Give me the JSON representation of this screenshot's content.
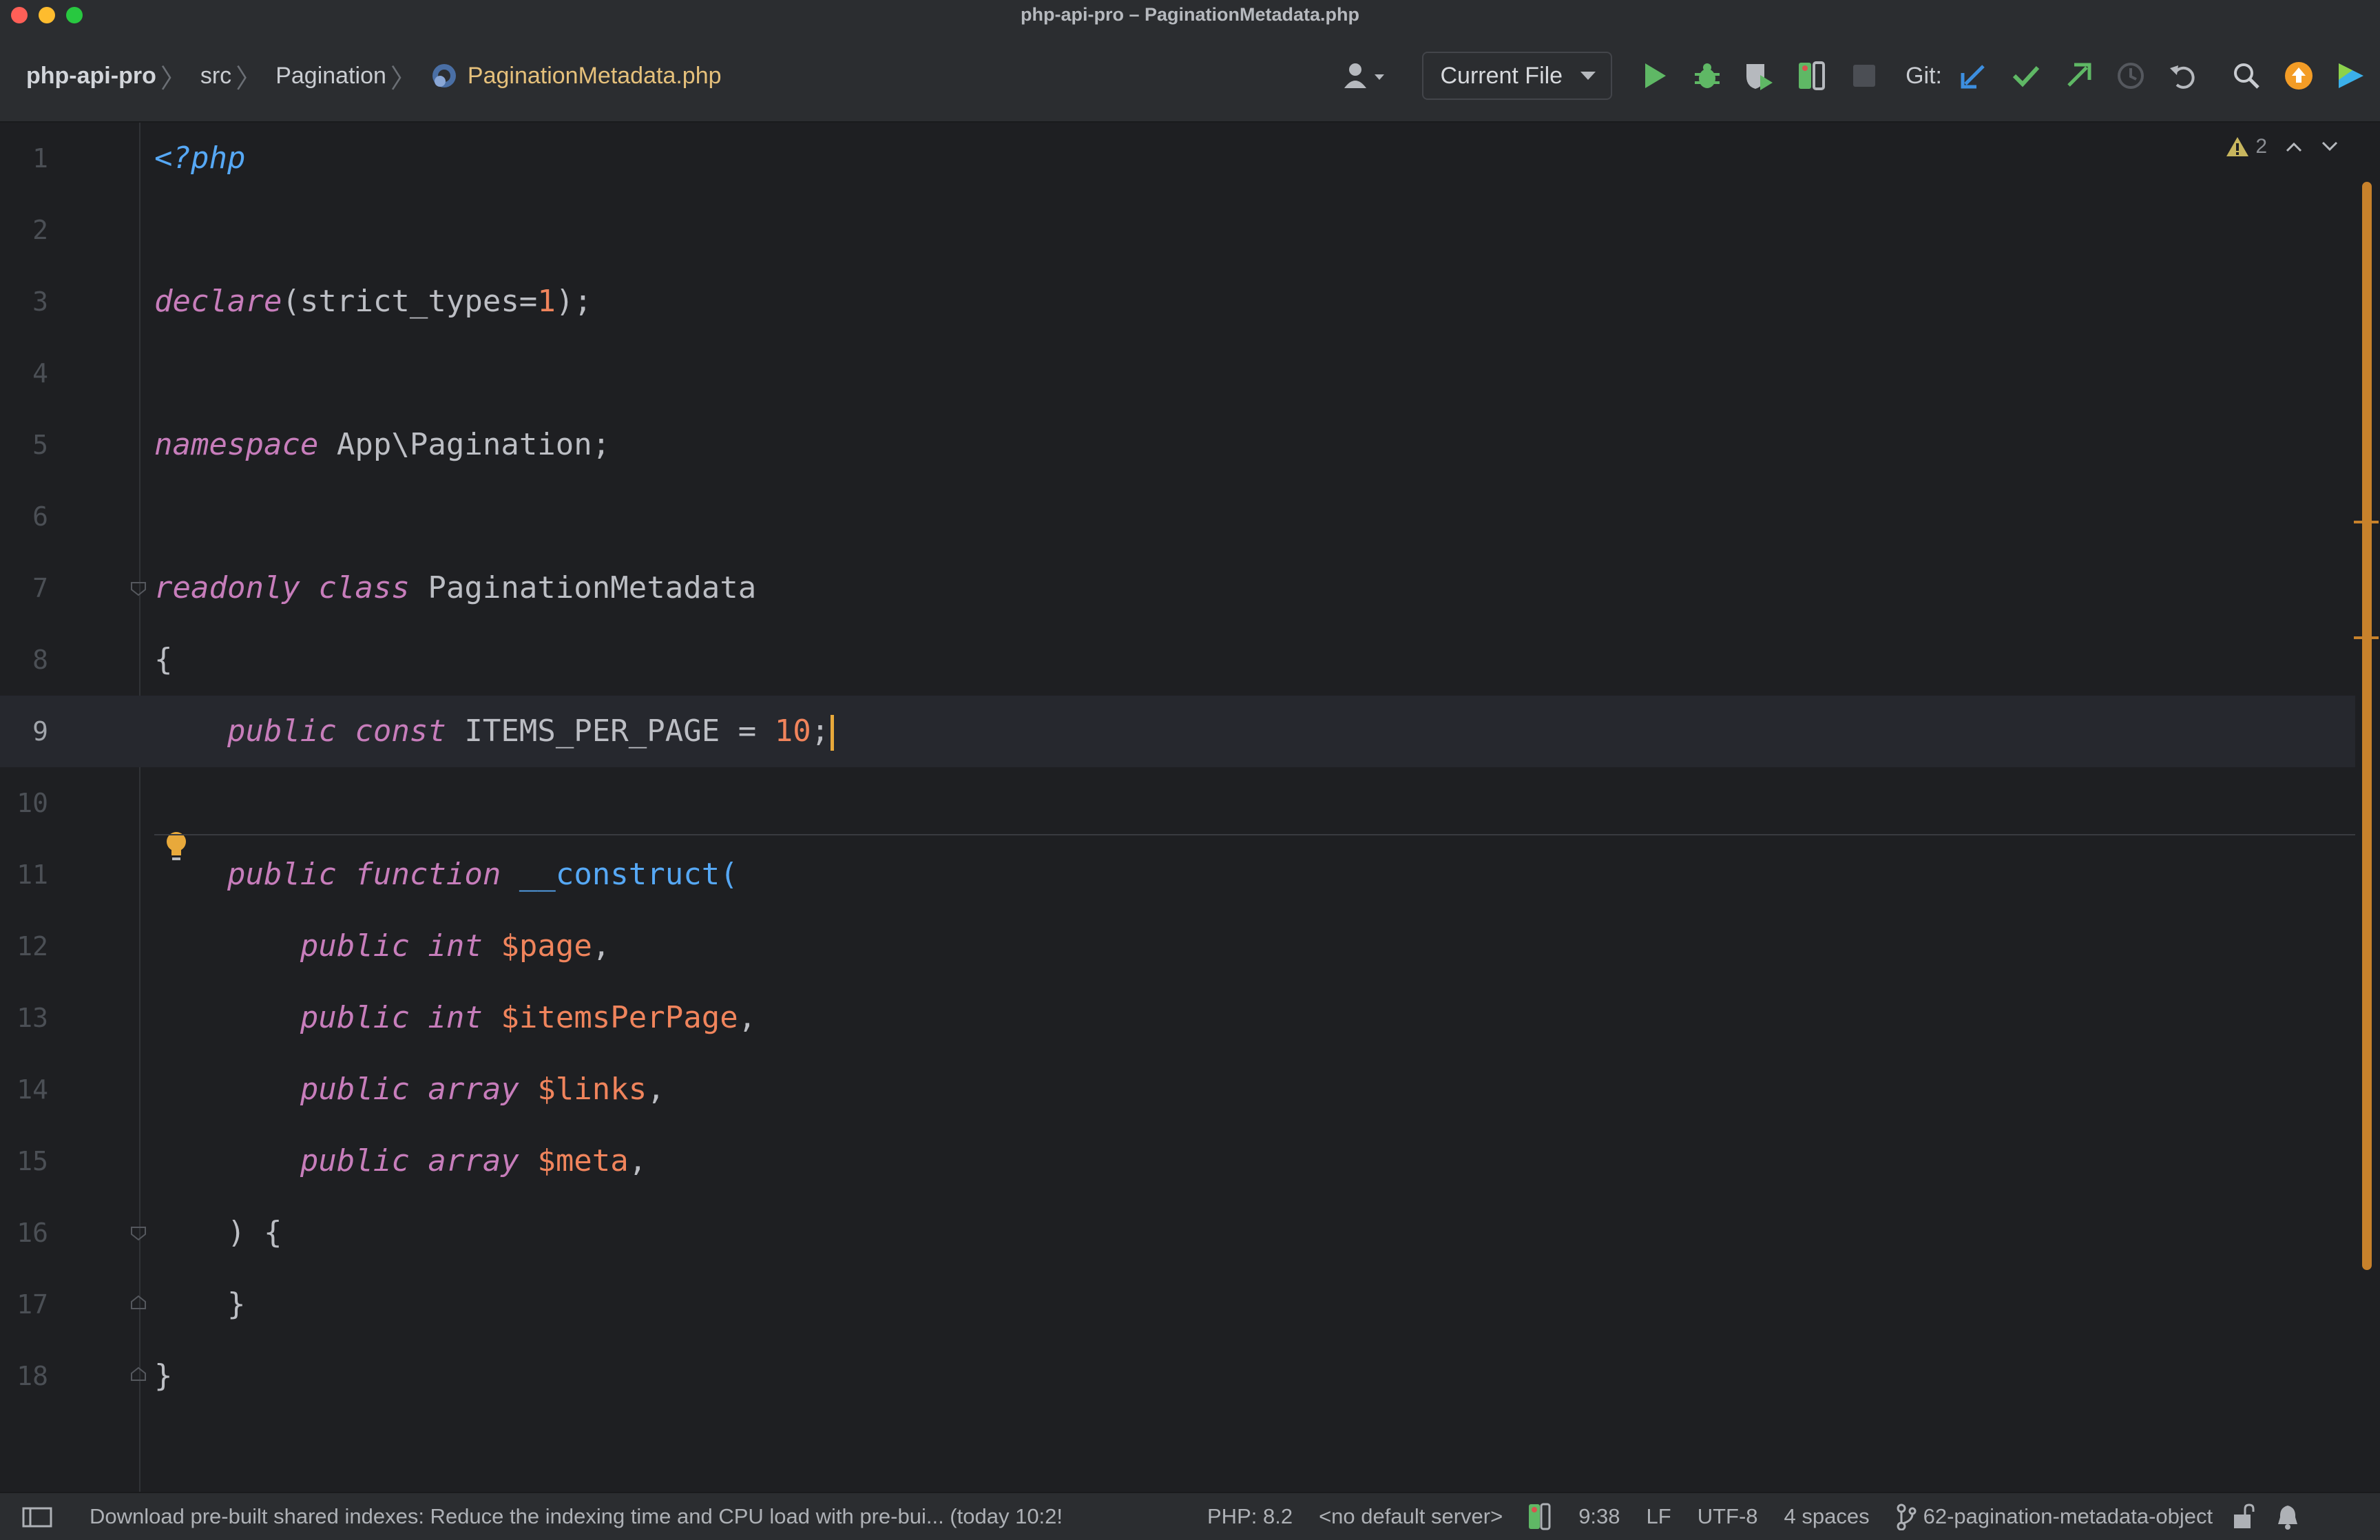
{
  "window": {
    "title": "php-api-pro – PaginationMetadata.php"
  },
  "breadcrumbs": [
    {
      "label": "php-api-pro"
    },
    {
      "label": "src"
    },
    {
      "label": "Pagination"
    },
    {
      "label": "PaginationMetadata.php"
    }
  ],
  "toolbar": {
    "run_config": "Current File",
    "git_label": "Git:"
  },
  "inspections": {
    "warning_count": "2"
  },
  "editor": {
    "language": "PHP",
    "current_line": 9,
    "line_numbers": [
      "1",
      "2",
      "3",
      "4",
      "5",
      "6",
      "7",
      "8",
      "9",
      "10",
      "11",
      "12",
      "13",
      "14",
      "15",
      "16",
      "17",
      "18"
    ],
    "code": {
      "l1_open_tag": "<?php",
      "l3_declare": "declare",
      "l3_args": "(strict_types=",
      "l3_num": "1",
      "l3_end": ");",
      "l5_kw": "namespace",
      "l5_name": " App\\Pagination;",
      "l7_kw1": "readonly",
      "l7_kw2": "class",
      "l7_name": " PaginationMetadata",
      "l8_brace": "{",
      "l9_kw1": "public",
      "l9_kw2": "const",
      "l9_name": " ITEMS_PER_PAGE = ",
      "l9_num": "10",
      "l9_end": ";",
      "l11_kw1": "public",
      "l11_kw2": "function",
      "l11_fn": "__construct",
      "l11_end": "(",
      "l12_kw1": "public",
      "l12_type": "int",
      "l12_var": "$page",
      "l12_end": ",",
      "l13_kw1": "public",
      "l13_type": "int",
      "l13_var": "$itemsPerPage",
      "l13_end": ",",
      "l14_kw1": "public",
      "l14_type": "array",
      "l14_var": "$links",
      "l14_end": ",",
      "l15_kw1": "public",
      "l15_type": "array",
      "l15_var": "$meta",
      "l15_end": ",",
      "l16_code": ") {",
      "l17_code": "}",
      "l18_code": "}"
    }
  },
  "statusbar": {
    "message": "Download pre-built shared indexes: Reduce the indexing time and CPU load with pre-bui... (today 10:2!",
    "php_version": "PHP: 8.2",
    "server": "<no default server>",
    "cursor_position": "9:38",
    "line_separator": "LF",
    "encoding": "UTF-8",
    "indent": "4 spaces",
    "branch": "62-pagination-metadata-object"
  },
  "colors": {
    "background": "#1e1f22",
    "keyword": "#c77dbb",
    "function": "#56a8f5",
    "variable": "#f0845c",
    "number": "#2aacb8",
    "accent": "#c7812b"
  },
  "icons": [
    "php-file-icon",
    "user-icon",
    "run-icon",
    "debug-icon",
    "coverage-icon",
    "profile-icon",
    "stop-icon",
    "git-update-icon",
    "git-commit-icon",
    "git-push-icon",
    "history-icon",
    "rollback-icon",
    "search-icon",
    "update-icon",
    "jetbrains-icon",
    "warning-icon",
    "lightbulb-icon",
    "panel-toggle-icon",
    "branch-icon",
    "lock-icon",
    "bell-icon"
  ]
}
